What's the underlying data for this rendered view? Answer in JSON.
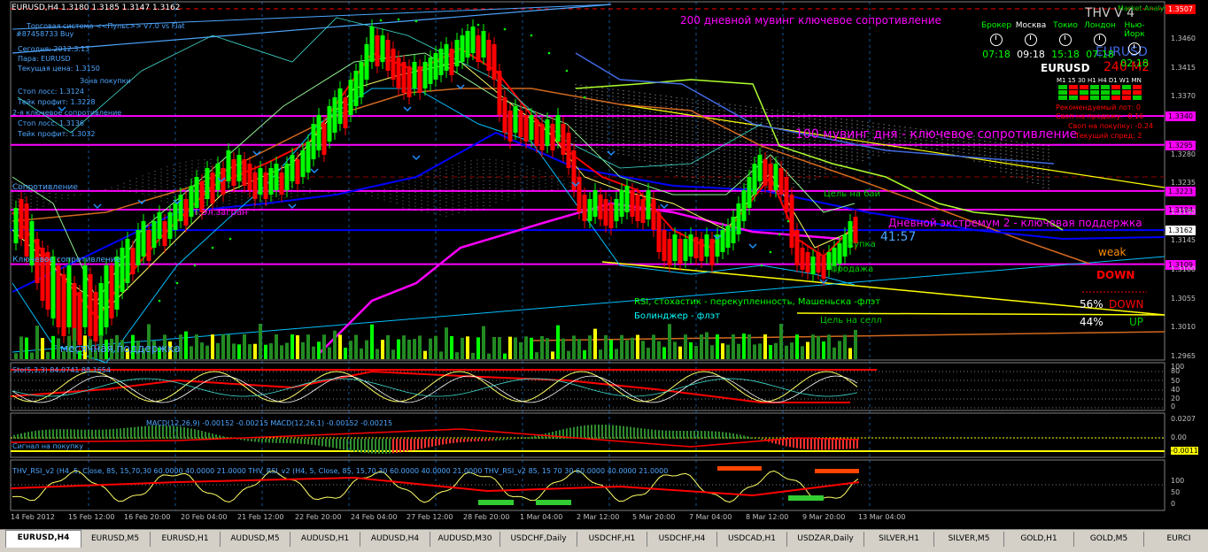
{
  "chart": {
    "title": "EURUSD,H4  1.3180 1.3185 1.3147 1.3162",
    "info_lines": [
      "Торговая система <<Пульс>> v7.0 vs Flat",
      "#87458733 Buy"
    ],
    "panel": {
      "today": "Сегодня:  2012.3.13",
      "pair": "Пара:  EURUSD",
      "price": "Текущая цена: 1.3150",
      "zone": "Зона покупки",
      "sl1": "Стоп лосс:    1.3124",
      "tp1": "Тейк профит:  1.3228",
      "key_zone": "2-я ключевое сопротивление",
      "sl2": "Стоп лосс:    1.3136",
      "tp2": "Тейк профит:  1.3032"
    },
    "labels": {
      "ma200": "200 дневной мувинг ключевое сопротивление",
      "ma100": "100 мувинг дня - ключевое сопротивление",
      "support2": "Дневной экстремум 2 - ключевая поддержка",
      "resist": "Сопротивление",
      "key_resist": "Ключевое сопротивление",
      "monthly": "месячная  поддержка",
      "target_buy": "Цель на бай",
      "buy": "Купка",
      "sell": "Продажа",
      "target_sell": "Цель на селл",
      "rsi_note": "RSI, стохастик - перекупленность, Машеньска -флэт",
      "boll_note": "Болинджер - флэт",
      "rb": "Т.Эл.загран",
      "timer": "41:57",
      "weak": "weak",
      "down": "DOWN",
      "pct_down": "56%",
      "pct_down_lbl": "DOWN",
      "pct_up": "44%",
      "pct_up_lbl": "UP"
    },
    "thv": {
      "title": "THV V 4",
      "subtitle": "Market Analysis",
      "pair": "EURUSD",
      "big": "EURUSD",
      "code": "240 M2",
      "timeframes": "M1 15 30 H1 H4 D1 W1 MN",
      "lot": "Рекомендуемый лот: 0",
      "swap_sell": "Своп на продажу: -0.16",
      "swap_buy": "Своп на покупку: -0.24",
      "spread": "Текущий спред: 2",
      "clocks": [
        {
          "city": "Брокер",
          "time": "07:18",
          "color": "#00ff00"
        },
        {
          "city": "Москва",
          "time": "09:18",
          "color": "#ffffff"
        },
        {
          "city": "Токио",
          "time": "15:18",
          "color": "#00ff00"
        },
        {
          "city": "Лондон",
          "time": "07:18",
          "color": "#00ff00"
        },
        {
          "city": "Нью-Йорк",
          "time": "02:18",
          "color": "#00ff00"
        }
      ]
    },
    "price_labels": [
      {
        "v": "1.3507",
        "c": "#ff0000",
        "fg": "#ffffff"
      },
      {
        "v": "1.3340",
        "c": "#ff00ff",
        "fg": "#000"
      },
      {
        "v": "1.3295",
        "c": "#ff00ff",
        "fg": "#000"
      },
      {
        "v": "1.3223",
        "c": "#ff00ff",
        "fg": "#000"
      },
      {
        "v": "1.3194",
        "c": "#ff00ff",
        "fg": "#000"
      },
      {
        "v": "1.3162",
        "c": "#ffffff",
        "fg": "#000"
      },
      {
        "v": "1.3109",
        "c": "#ff00ff",
        "fg": "#000"
      }
    ],
    "axis_prices": [
      "1.3460",
      "1.3415",
      "1.3370",
      "1.3280",
      "1.3235",
      "1.3190",
      "1.3145",
      "1.3100",
      "1.3055",
      "1.3010",
      "1.2965"
    ],
    "stoch": {
      "title": "Sto(5,3,3) 84.0741 88.1654",
      "levels": [
        "100",
        "80",
        "50",
        "40",
        "20",
        "0"
      ]
    },
    "macd": {
      "title": "MACD(12,26,9) -0.00152 -0.00215  MACD(12,26,1) -0.00152 -0.00215",
      "axis": [
        "0.0207",
        "0.00",
        "-0.0011"
      ],
      "signal": "Сигнал на покупку"
    },
    "rsi": {
      "title": "THV_RSI_v2 (H4, 5, Close, 85, 15,70,30 60.0000 40.0000 21.0000    THV_RSI_v2   (H4, 5, Close, 85, 15,70,30 60.0000 40.0000 21.0000     THV_RSI_v2   85, 15 70 30 60.0000 40.0000 21.0000",
      "levels": [
        "100",
        "50",
        "0"
      ]
    },
    "dates": [
      "14 Feb 2012",
      "15 Feb 12:00",
      "16 Feb 20:00",
      "20 Feb 04:00",
      "21 Feb 12:00",
      "22 Feb 20:00",
      "24 Feb 04:00",
      "27 Feb 12:00",
      "28 Feb 20:00",
      "1 Mar 04:00",
      "2 Mar 12:00",
      "5 Mar 20:00",
      "7 Mar 04:00",
      "8 Mar 12:00",
      "9 Mar 20:00",
      "13 Mar 04:00"
    ]
  },
  "tabs": [
    "EURUSD,H4",
    "EURUSD,M5",
    "EURUSD,H1",
    "AUDUSD,M5",
    "AUDUSD,H1",
    "AUDUSD,H4",
    "AUDUSD,M30",
    "USDCHF,Daily",
    "USDCHF,H1",
    "USDCHF,H4",
    "USDCAD,H1",
    "USDZAR,Daily",
    "SILVER,H1",
    "SILVER,M5",
    "GOLD,H1",
    "GOLD,M5",
    "EURCI"
  ],
  "colors": {
    "bull": "#00ff00",
    "bear": "#ff0000",
    "magenta": "#ff00ff",
    "blue": "#0000ff",
    "yellow": "#ffff00"
  }
}
